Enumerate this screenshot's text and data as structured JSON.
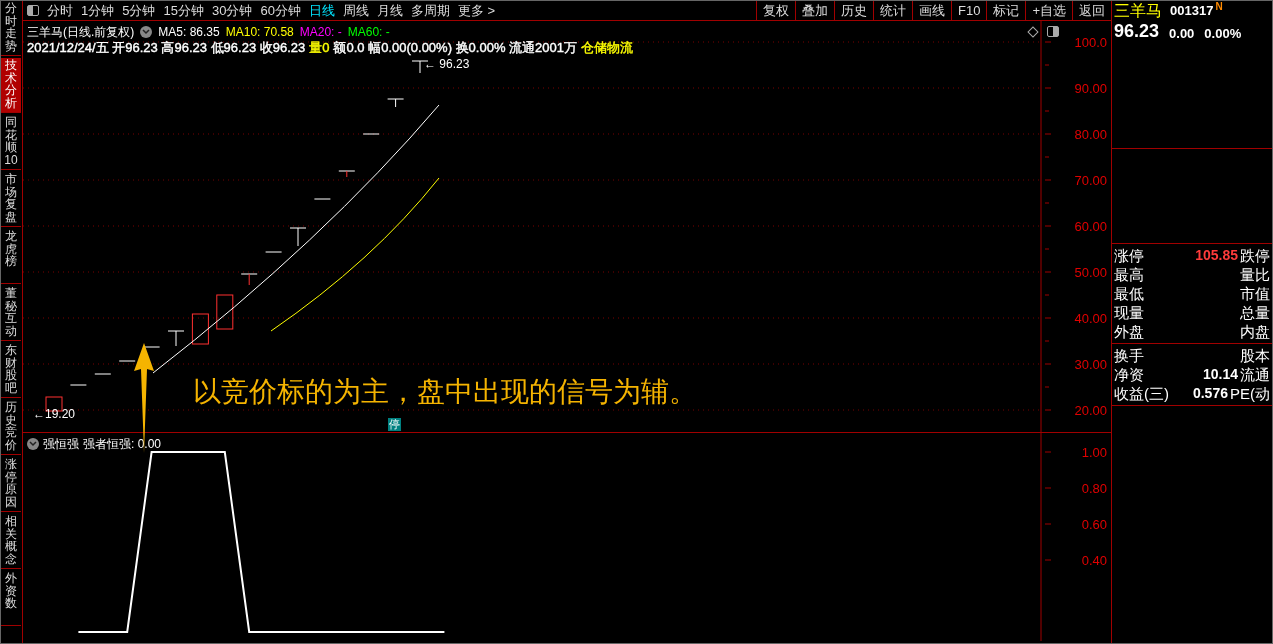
{
  "sidebar": {
    "tabs": [
      {
        "label": "分时走势",
        "selected": false
      },
      {
        "label": "技术分析",
        "selected": true
      },
      {
        "label": "同花顺10",
        "selected": false
      },
      {
        "label": "市场复盘",
        "selected": false
      },
      {
        "label": "龙虎榜",
        "selected": false
      },
      {
        "label": "董秘互动",
        "selected": false
      },
      {
        "label": "东财股吧",
        "selected": false
      },
      {
        "label": "历史竞价",
        "selected": false
      },
      {
        "label": "涨停原因",
        "selected": false
      },
      {
        "label": "相关概念",
        "selected": false
      },
      {
        "label": "外资数",
        "selected": false
      }
    ]
  },
  "toolbar": {
    "periods": [
      {
        "label": "分时",
        "selected": false
      },
      {
        "label": "1分钟",
        "selected": false
      },
      {
        "label": "5分钟",
        "selected": false
      },
      {
        "label": "15分钟",
        "selected": false
      },
      {
        "label": "30分钟",
        "selected": false
      },
      {
        "label": "60分钟",
        "selected": false
      },
      {
        "label": "日线",
        "selected": true
      },
      {
        "label": "周线",
        "selected": false
      },
      {
        "label": "月线",
        "selected": false
      },
      {
        "label": "多周期",
        "selected": false
      },
      {
        "label": "更多 >",
        "selected": false
      }
    ],
    "buttons": [
      "复权",
      "叠加",
      "历史",
      "统计",
      "画线",
      "F10",
      "标记",
      "+自选",
      "返回"
    ]
  },
  "price_chart": {
    "title": "三羊马(日线.前复权)",
    "ma_legend": [
      {
        "text": "MA5: 86.35",
        "color": "#ffffff"
      },
      {
        "text": "MA10: 70.58",
        "color": "#ffff00"
      },
      {
        "text": "MA20: -",
        "color": "#ff00ff"
      },
      {
        "text": "MA60: -",
        "color": "#00ff00"
      }
    ],
    "bar_info": [
      {
        "text": "2021/12/24/五 开96.23 高96.23 低96.23 收96.23",
        "color": "#ffffff"
      },
      {
        "text": "量0",
        "color": "#ffff00"
      },
      {
        "text": "额0.0 幅0.00(0.00%) 换0.00% 流通2001万",
        "color": "#ffffff"
      },
      {
        "text": "仓储物流",
        "color": "#ffff00"
      }
    ],
    "high_marker": "← 96.23",
    "low_marker": "←19.20",
    "limit_badge": "停",
    "axis_labels": [
      "100.0",
      "90.00",
      "80.00",
      "70.00",
      "60.00",
      "50.00",
      "40.00",
      "30.00",
      "20.00"
    ]
  },
  "annotation": "以竞价标的为主，盘中出现的信号为辅。",
  "indicator": {
    "name": "强恒强",
    "reading": "强者恒强: 0.00",
    "axis_labels": [
      "1.00",
      "0.80",
      "0.60",
      "0.40"
    ]
  },
  "quote": {
    "name": "三羊马",
    "code": "001317",
    "flag": "N",
    "price": "96.23",
    "change": "0.00",
    "change_pct": "0.00%",
    "fields": [
      [
        {
          "label": "涨停",
          "value": "105.85",
          "right": "跌停",
          "color": "#ff3b3b"
        },
        {
          "label": "最高",
          "right": "量比"
        },
        {
          "label": "最低",
          "right": "市值"
        },
        {
          "label": "现量",
          "right": "总量"
        },
        {
          "label": "外盘",
          "right": "内盘"
        }
      ],
      [
        {
          "label": "换手",
          "right": "股本"
        },
        {
          "label": "净资",
          "value": "10.14",
          "right": "流通",
          "color": "#ffffff"
        },
        {
          "label": "收益(三)",
          "value": "0.576",
          "right": "PE(动",
          "color": "#ffffff"
        }
      ]
    ]
  }
}
